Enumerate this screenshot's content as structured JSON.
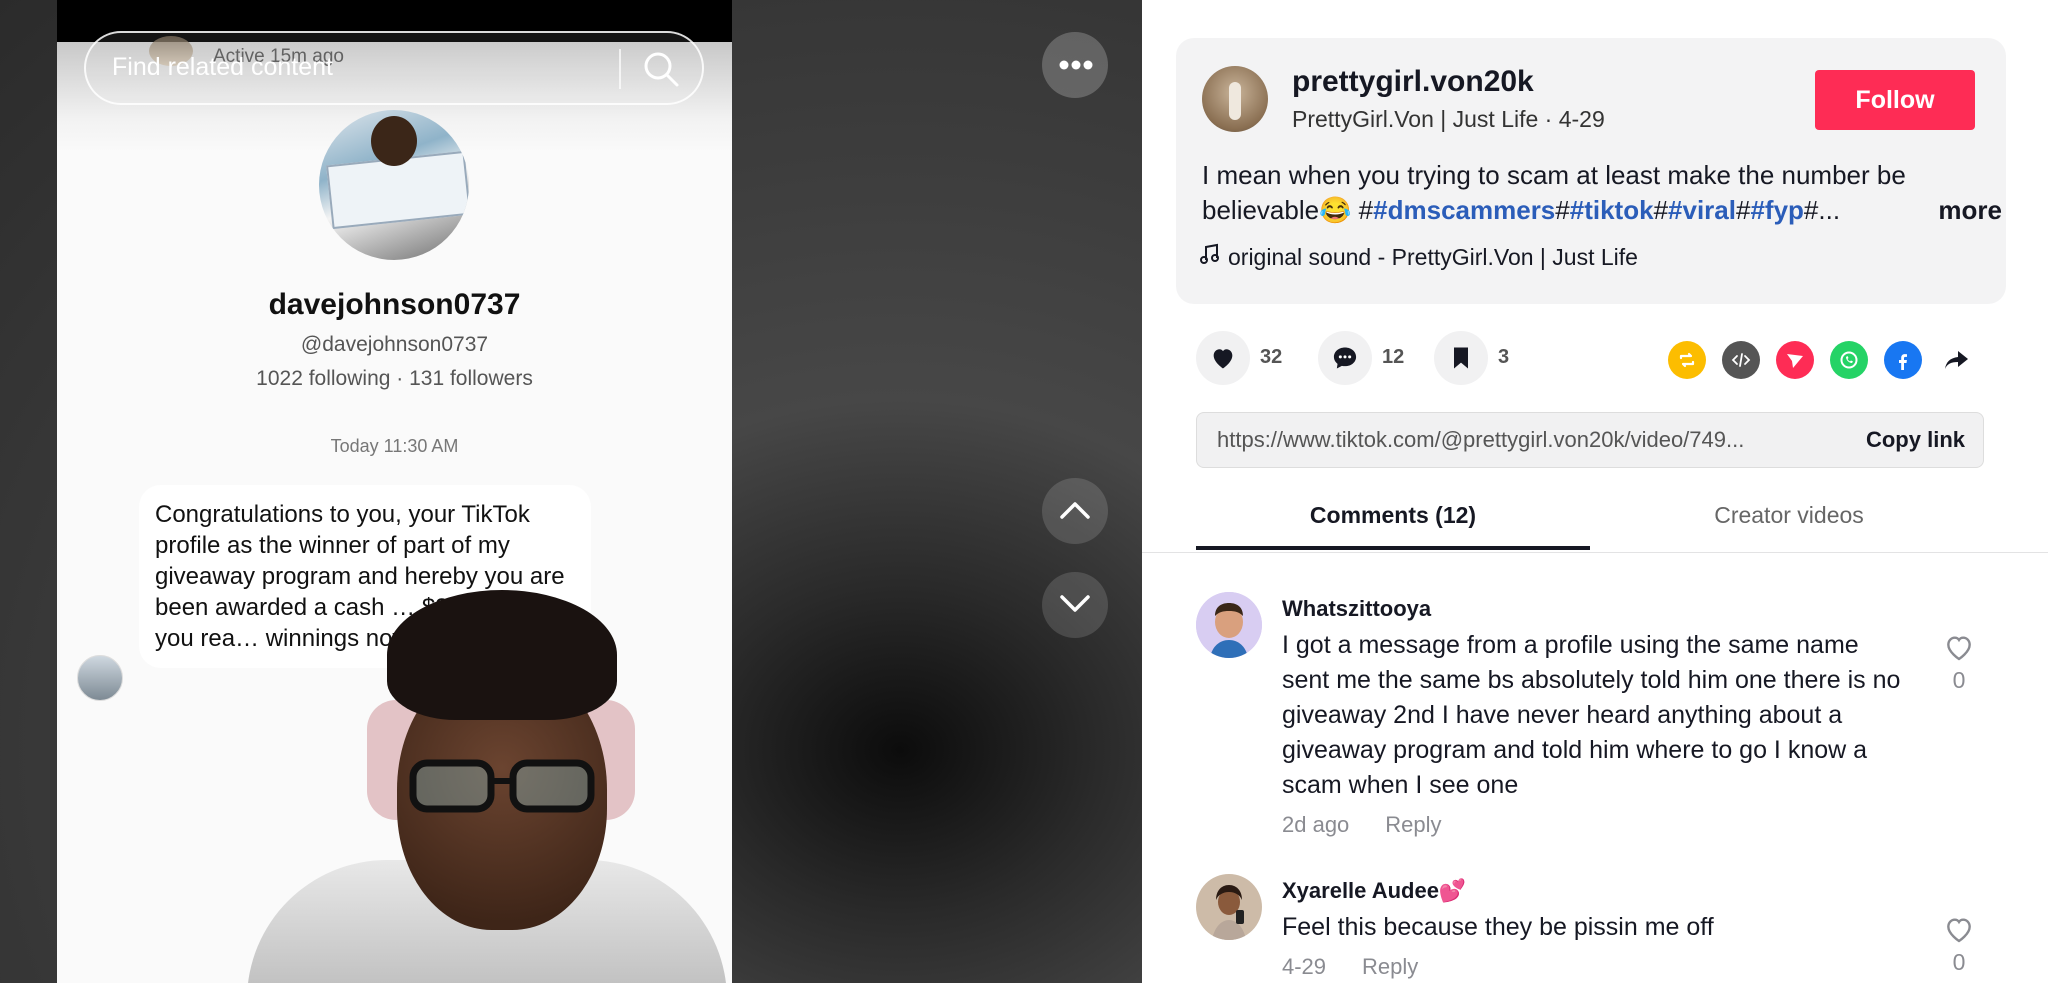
{
  "video": {
    "search_placeholder": "Find related content",
    "dm_active": "Active 15m ago",
    "dm_username": "davejohnson0737",
    "dm_handle": "@davejohnson0737",
    "dm_stats": "1022 following · 131 followers",
    "dm_date": "Today 11:30 AM",
    "dm_message": "Congratulations to you, your TikTok profile as the winner of part of my giveaway program and hereby you are been awarded a cash … $30,000. Are you rea… winnings now?"
  },
  "post": {
    "author_username": "prettygirl.von20k",
    "author_subtitle": "PrettyGirl.Von | Just Life · 4-29",
    "follow_label": "Follow",
    "caption_text": "I mean when you trying to scam at least make the number be believable😂 #",
    "caption_tag1": "#dmscammers",
    "caption_sep1": "#",
    "caption_tag2": "#tiktok",
    "caption_sep2": "#",
    "caption_tag3": "#viral",
    "caption_sep3": "#",
    "caption_tag4": "#fyp",
    "caption_tail": "#...",
    "more_label": "more",
    "sound": "original sound - PrettyGirl.Von | Just Life"
  },
  "actions": {
    "likes": "32",
    "comments": "12",
    "saves": "3"
  },
  "share_icons": [
    "repost-icon",
    "embed-icon",
    "send-icon",
    "whatsapp-icon",
    "facebook-icon",
    "share-arrow-icon"
  ],
  "colors": {
    "follow": "#fe2c55",
    "tag": "#2b5db9",
    "repost": "#fcbd00",
    "embed": "#555555",
    "send": "#fe2c55",
    "whatsapp": "#25d366",
    "facebook": "#1877f2"
  },
  "link": {
    "url": "https://www.tiktok.com/@prettygirl.von20k/video/749...",
    "copy_label": "Copy link"
  },
  "tabs": {
    "comments": "Comments (12)",
    "creator": "Creator videos"
  },
  "comments": [
    {
      "name": "Whatszittooya",
      "text": "I got a message from a profile using the same name sent me the same bs absolutely told him one there is no giveaway 2nd I have never heard anything about a giveaway program and told him where to go I know a scam when I see one",
      "date": "2d ago",
      "reply": "Reply",
      "likes": "0"
    },
    {
      "name": "Xyarelle Audee💕",
      "text": "Feel this because they be pissin me off",
      "date": "4-29",
      "reply": "Reply",
      "likes": "0"
    }
  ]
}
